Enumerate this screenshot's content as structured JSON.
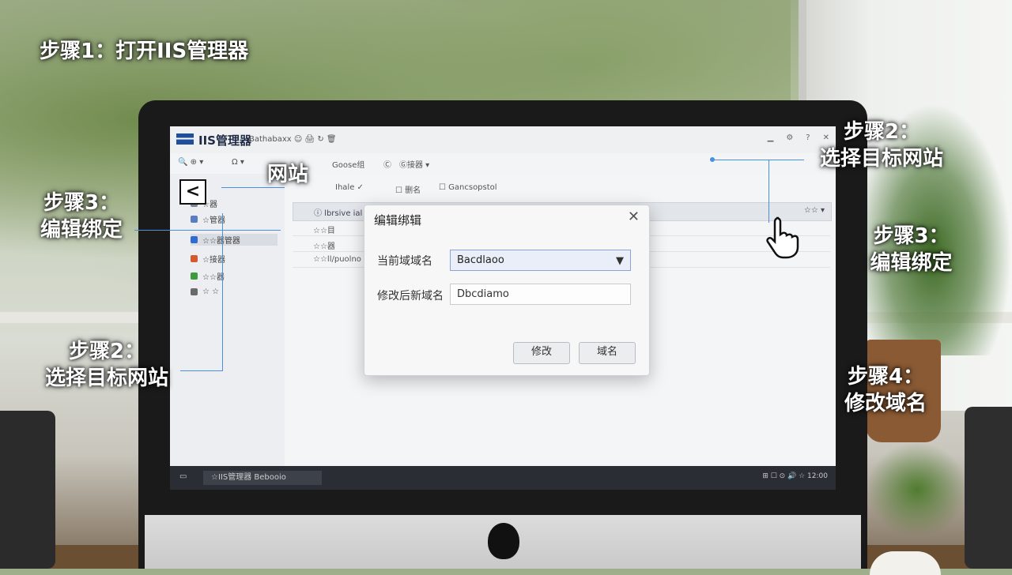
{
  "annotations": {
    "step1": "步骤1：打开IIS管理器",
    "step2_right_line1": "步骤2：",
    "step2_right_line2": "选择目标网站",
    "step3_left_line1": "步骤3：",
    "step3_left_line2": "编辑绑定",
    "step3_right_line1": "步骤3：",
    "step3_right_line2": "编辑绑定",
    "step2_left_line1": "步骤2：",
    "step2_left_line2": "选择目标网站",
    "step4_line1": "步骤4：",
    "step4_line2": "修改域名",
    "sites_label": "网站"
  },
  "app": {
    "title": "IIS管理器",
    "subtitle": "Bathabaxx ☺ 🖨 ↻ 🗑"
  },
  "toolbar": {
    "items": [
      "🔍 ⊕ ▾",
      "Ω ▾",
      "Goose组",
      "Ⓒ",
      "Ⓖ接器 ▾"
    ]
  },
  "sidebar": {
    "items": [
      "☆器",
      "☆管器",
      "☆☆器管器",
      "☆接器",
      "☆☆器",
      "☆ ☆"
    ]
  },
  "main": {
    "filter": [
      "Ihale ✓",
      "☐ 删名",
      "☐ Gancsopstol"
    ],
    "grid_header": "ⓘ lbrsive ial",
    "grid_rows": [
      "☆☆目",
      "☆☆器",
      "☆☆ll/puolno"
    ],
    "dropdown_hint": "☆☆ ▾"
  },
  "dialog": {
    "title": "编辑绑辑",
    "close": "✕",
    "current_domain_label": "当前域域名",
    "current_domain_value": "Bacdlaoo",
    "new_domain_label": "修改后新域名",
    "new_domain_value": "Dbcdiamo",
    "button_modify": "修改",
    "button_domain": "域名"
  },
  "taskbar": {
    "item": "☆IIS管理器 Bebooio",
    "tray": "⊞ ☐ ⊙ 🔊 ☆ 12:00"
  }
}
